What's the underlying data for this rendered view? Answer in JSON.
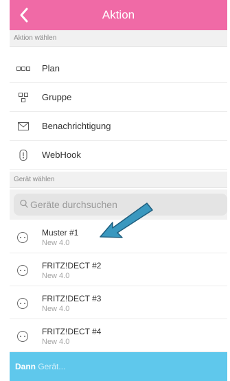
{
  "header": {
    "title": "Aktion"
  },
  "sections": {
    "action": "Aktion wählen",
    "device": "Gerät wählen"
  },
  "actions": [
    {
      "label": "Plan",
      "icon": "calendar-icon"
    },
    {
      "label": "Gruppe",
      "icon": "group-icon"
    },
    {
      "label": "Benachrichtigung",
      "icon": "envelope-icon"
    },
    {
      "label": "WebHook",
      "icon": "webhook-icon"
    }
  ],
  "search": {
    "placeholder": "Geräte durchsuchen"
  },
  "devices": [
    {
      "name": "Muster #1",
      "sub": "New 4.0"
    },
    {
      "name": "FRITZ!DECT #2",
      "sub": "New 4.0"
    },
    {
      "name": "FRITZ!DECT #3",
      "sub": "New 4.0"
    },
    {
      "name": "FRITZ!DECT #4",
      "sub": "New 4.0"
    }
  ],
  "footer": {
    "bold": "Dann",
    "placeholder": "Gerät..."
  },
  "colors": {
    "header": "#f06aa6",
    "footer": "#5fc8ec",
    "arrow": "#3a98bf"
  }
}
